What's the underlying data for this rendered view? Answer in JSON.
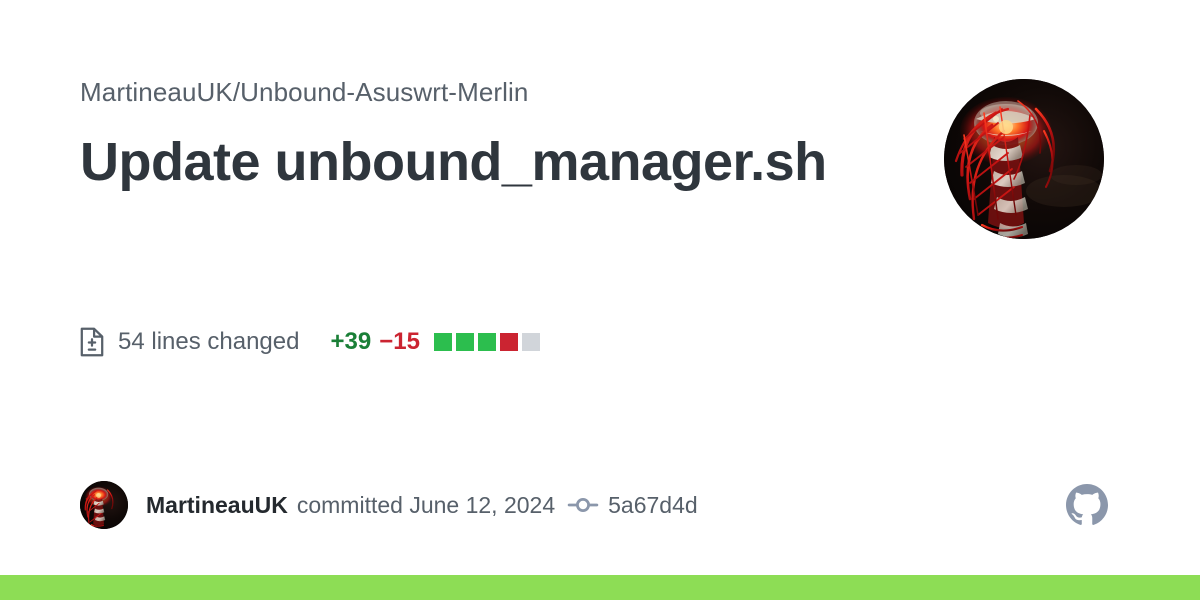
{
  "page": {
    "background_color": "#ffffff",
    "accent_bar_color": "#8ddd55"
  },
  "header": {
    "repo_path": "MartineauUK/Unbound-Asuswrt-Merlin",
    "commit_title": "Update unbound_manager.sh",
    "repo_path_color": "#57606a",
    "title_color": "#2f363d"
  },
  "owner_avatar": {
    "icon": "user-avatar-image",
    "alt": "MartineauUK avatar",
    "description": "Red illuminated lattice tower at night"
  },
  "stats": {
    "file_diff_icon": "file-diff-icon",
    "lines_changed": "54 lines changed",
    "additions": "+39",
    "deletions": "−15",
    "additions_color": "#1a7f37",
    "deletions_color": "#cb2431",
    "diff_blocks": [
      {
        "type": "add",
        "color": "#2cbe4e"
      },
      {
        "type": "add",
        "color": "#2cbe4e"
      },
      {
        "type": "add",
        "color": "#2cbe4e"
      },
      {
        "type": "del",
        "color": "#cb2431"
      },
      {
        "type": "neutral",
        "color": "#d1d5da"
      }
    ]
  },
  "footer": {
    "author_avatar_icon": "user-avatar-image",
    "author": "MartineauUK",
    "committed_text": "committed June 12, 2024",
    "commit_icon": "git-commit-icon",
    "commit_hash": "5a67d4d",
    "brand_icon": "github-mark-icon",
    "brand_icon_color": "#8b97ab"
  }
}
